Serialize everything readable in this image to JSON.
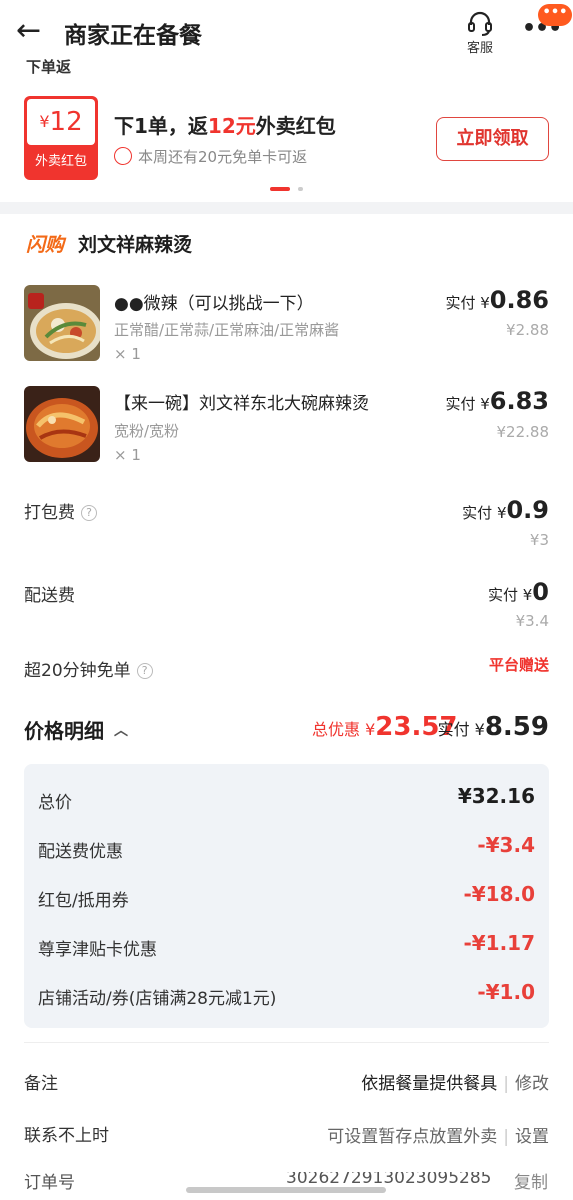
{
  "header": {
    "back_icon": "←",
    "title": "商家正在备餐",
    "service_label": "客服",
    "more_icon": "•••",
    "more_badge": "•••"
  },
  "partial_label": "下单返",
  "promo": {
    "coupon_amount": "12",
    "coupon_currency": "¥",
    "coupon_caption": "外卖红包",
    "main_pre": "下1单，返",
    "main_amount": "12元",
    "main_post": "外卖红包",
    "sub_text": "本周还有20元免单卡可返",
    "claim_button": "立即领取",
    "accent_color": "#f0342e"
  },
  "store": {
    "flash_tag": "闪购",
    "name": "刘文祥麻辣烫"
  },
  "items": [
    {
      "name": "●●微辣（可以挑战一下）",
      "spec": "正常醋/正常蒜/正常麻油/正常麻酱",
      "qty": "× 1",
      "paid_prefix": "实付 ¥",
      "paid": "0.86",
      "original": "¥2.88"
    },
    {
      "name": "【来一碗】刘文祥东北大碗麻辣烫",
      "spec": "宽粉/宽粉",
      "qty": "× 1",
      "paid_prefix": "实付 ¥",
      "paid": "6.83",
      "original": "¥22.88"
    }
  ],
  "fees": {
    "packing_label": "打包费",
    "packing_paid_prefix": "实付 ¥",
    "packing_paid": "0.9",
    "packing_original": "¥3",
    "delivery_label": "配送费",
    "delivery_paid_prefix": "实付 ¥",
    "delivery_paid": "0",
    "delivery_original": "¥3.4",
    "free_label": "超20分钟免单",
    "free_value": "平台赠送",
    "help_icon": "?"
  },
  "price": {
    "title": "价格明细",
    "chevron": "︿",
    "discount_prefix": "总优惠 ¥",
    "discount": "23.57",
    "paid_prefix": "实付 ¥",
    "paid": "8.59"
  },
  "breakdown": [
    {
      "label": "总价",
      "value": "¥32.16"
    },
    {
      "label": "配送费优惠",
      "value": "-¥3.4"
    },
    {
      "label": "红包/抵用券",
      "value": "-¥18.0"
    },
    {
      "label": "尊享津贴卡优惠",
      "value": "-¥1.17"
    },
    {
      "label": "店铺活动/券(店铺满28元减1元)",
      "value": "-¥1.0"
    }
  ],
  "remarks": {
    "label": "备注",
    "value": "依据餐量提供餐具",
    "action": "修改"
  },
  "unreachable": {
    "label": "联系不上时",
    "value": "可设置暂存点放置外卖",
    "action": "设置"
  },
  "order": {
    "label": "订单号",
    "value": "3026272913023095285",
    "action": "复制"
  }
}
